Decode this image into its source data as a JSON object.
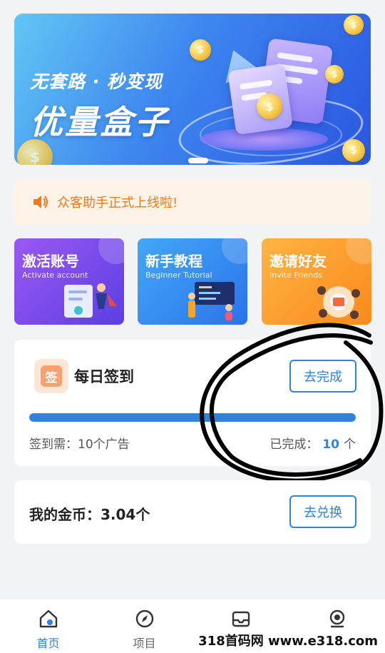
{
  "banner": {
    "title_small": "无套路 · 秒变现",
    "title_big": "优量盒子",
    "coin_glyph": "$"
  },
  "notice": {
    "icon": "speaker-icon",
    "text": "众客助手正式上线啦!"
  },
  "cards": [
    {
      "title": "激活账号",
      "subtitle": "Activate account"
    },
    {
      "title": "新手教程",
      "subtitle": "Beginner Tutorial"
    },
    {
      "title": "邀请好友",
      "subtitle": "Invite Friends"
    }
  ],
  "checkin": {
    "icon_char": "签",
    "title": "每日签到",
    "button": "去完成",
    "progress": 1.0,
    "required_text": "签到需：10个广告",
    "done_prefix": "已完成：",
    "done_count": "10",
    "done_suffix": "个"
  },
  "coins": {
    "label": "我的金币：3.04个",
    "button": "去兑换"
  },
  "nav": [
    {
      "label": "首页",
      "icon": "home-icon",
      "active": true
    },
    {
      "label": "项目",
      "icon": "compass-icon",
      "active": false
    },
    {
      "label": "",
      "icon": "inbox-icon",
      "active": false
    },
    {
      "label": "",
      "icon": "profile-icon",
      "active": false
    }
  ],
  "watermark": "318首码网 www.e318.com",
  "colors": {
    "accent": "#2f82dd",
    "notice_text": "#f07a1e",
    "notice_bg": "#fdf3e6"
  }
}
